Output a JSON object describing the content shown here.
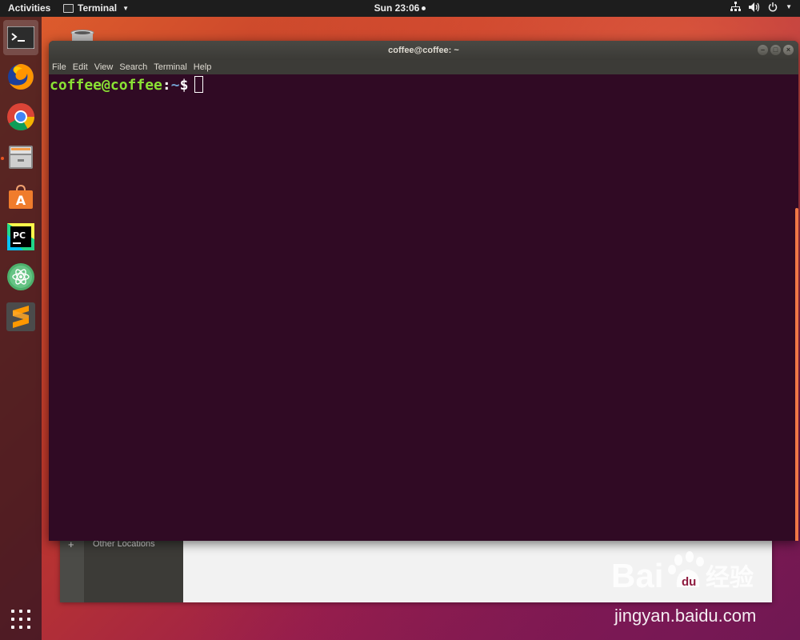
{
  "topbar": {
    "activities": "Activities",
    "app_menu": "Terminal",
    "clock": "Sun 23:06"
  },
  "dock": {
    "items": [
      {
        "name": "terminal",
        "active": true
      },
      {
        "name": "firefox"
      },
      {
        "name": "chrome"
      },
      {
        "name": "files"
      },
      {
        "name": "software-center"
      },
      {
        "name": "pycharm",
        "label": "PC"
      },
      {
        "name": "atom"
      },
      {
        "name": "sublime-text"
      }
    ]
  },
  "terminal": {
    "title": "coffee@coffee: ~",
    "menu": [
      "File",
      "Edit",
      "View",
      "Search",
      "Terminal",
      "Help"
    ],
    "prompt_user": "coffee@coffee",
    "prompt_colon": ":",
    "prompt_path": "~",
    "prompt_dollar": "$"
  },
  "behind_window": {
    "other_locations": "Other Locations",
    "plus": "+"
  },
  "watermark": {
    "logo": "Bai du 经验",
    "site": "jingyan.baidu.com"
  },
  "colors": {
    "accent": "#e95420",
    "terminal_bg": "#300a24",
    "prompt_user": "#8ae234",
    "prompt_path": "#729fcf"
  }
}
